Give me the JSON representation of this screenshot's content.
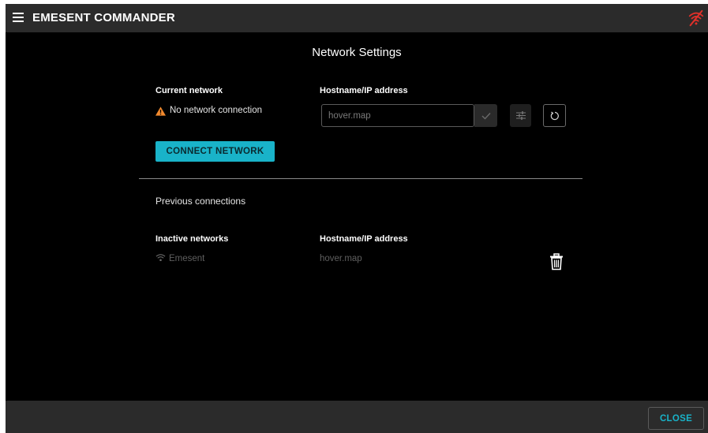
{
  "header": {
    "title": "EMESENT COMMANDER",
    "menu_icon": "hamburger-menu-icon",
    "status_icon": "wifi-off-icon",
    "status_color": "#e0302a"
  },
  "page": {
    "title": "Network Settings"
  },
  "current": {
    "label": "Current network",
    "status_text": "No network connection",
    "status_icon": "warning-icon",
    "warning_color": "#f28a2e",
    "connect_button": "CONNECT NETWORK"
  },
  "host": {
    "label": "Hostname/IP address",
    "placeholder": "hover.map",
    "value": ""
  },
  "previous": {
    "title": "Previous connections",
    "inactive_label": "Inactive networks",
    "host_label": "Hostname/IP address",
    "networks": [
      {
        "name": "Emesent",
        "host": "hover.map",
        "icon": "wifi-icon"
      }
    ]
  },
  "footer": {
    "close_button": "CLOSE"
  },
  "colors": {
    "accent": "#19b3c9",
    "background": "#000000",
    "bar": "#2b2b2b"
  }
}
